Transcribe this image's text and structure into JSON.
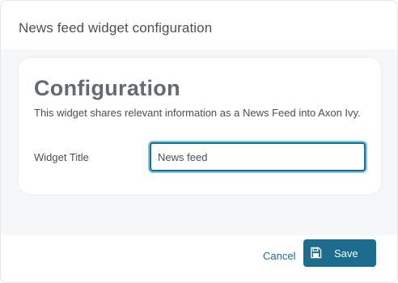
{
  "dialog": {
    "title": "News feed widget configuration"
  },
  "card": {
    "title": "Configuration",
    "description": "This widget shares relevant information as a News Feed into Axon Ivy."
  },
  "form": {
    "widget_title_label": "Widget Title",
    "widget_title_value": "News feed"
  },
  "footer": {
    "cancel_label": "Cancel",
    "save_label": "Save",
    "save_icon": "save-icon"
  },
  "colors": {
    "accent": "#1b6c8f",
    "focus_ring": "#7ec8e3",
    "text": "#495057",
    "heading": "#646a73"
  }
}
